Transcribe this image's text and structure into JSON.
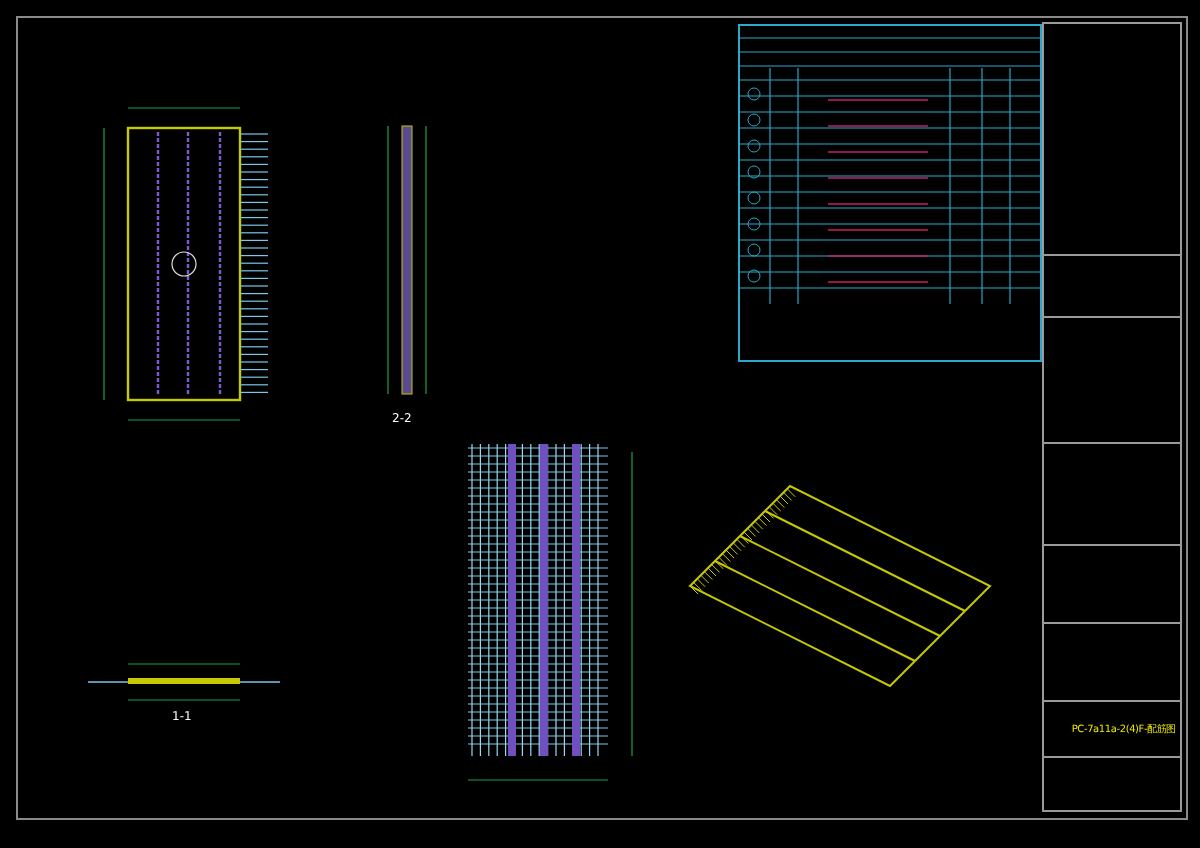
{
  "views": [
    {
      "label": "2-2"
    },
    {
      "label": "1-1"
    }
  ],
  "title_block": {
    "drawing_title": "PC-7a11a-2(4)F-配筋图"
  }
}
